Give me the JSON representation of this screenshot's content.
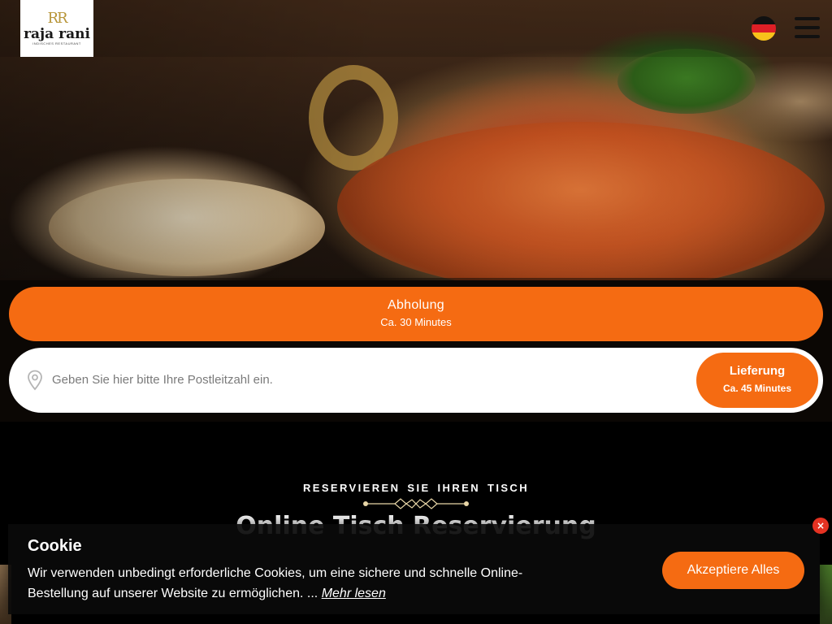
{
  "brand": {
    "logo_name": "raja rani",
    "logo_sub": "INDISCHES RESTAURANT",
    "logo_mark": "RR",
    "accent_color": "#f56b12"
  },
  "header": {
    "language_icon": "germany-flag-icon",
    "menu_icon": "hamburger-menu-icon"
  },
  "order": {
    "pickup_label": "Abholung",
    "pickup_time": "Ca. 30 Minutes",
    "zip_placeholder": "Geben Sie hier bitte Ihre Postleitzahl ein.",
    "zip_icon": "location-pin-icon",
    "delivery_label": "Lieferung",
    "delivery_time": "Ca. 45 Minutes"
  },
  "reservation": {
    "eyebrow": "RESERVIEREN SIE IHREN TISCH",
    "title": "Online Tisch Reservierung"
  },
  "cookie": {
    "title": "Cookie",
    "text": "Wir verwenden unbedingt erforderliche Cookies, um eine sichere und schnelle Online-Bestellung auf unserer Website zu ermöglichen. ...",
    "read_more": "Mehr lesen",
    "accept_label": "Akzeptiere Alles",
    "close_label": "×"
  }
}
